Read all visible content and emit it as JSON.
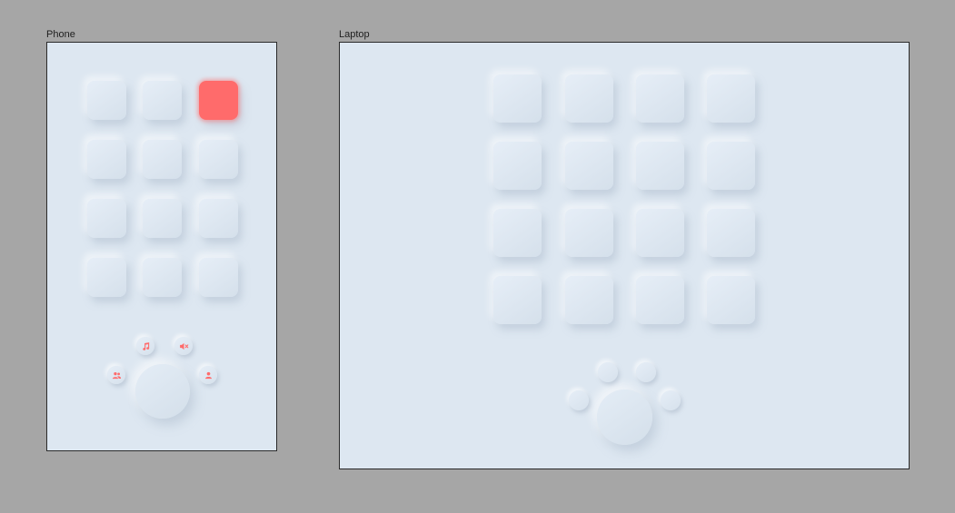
{
  "phone": {
    "label": "Phone",
    "tile_count": 12,
    "active_tile_index": 2,
    "buttons": [
      {
        "icon": "music-note-icon"
      },
      {
        "icon": "mute-icon"
      },
      {
        "icon": "group-icon"
      },
      {
        "icon": "user-icon"
      }
    ]
  },
  "laptop": {
    "label": "Laptop",
    "tile_count": 16,
    "buttons": [
      {
        "icon": ""
      },
      {
        "icon": ""
      },
      {
        "icon": ""
      },
      {
        "icon": ""
      }
    ]
  },
  "colors": {
    "canvas": "#a6a6a6",
    "surface": "#dde7f1",
    "accent": "#ff6b6b"
  }
}
